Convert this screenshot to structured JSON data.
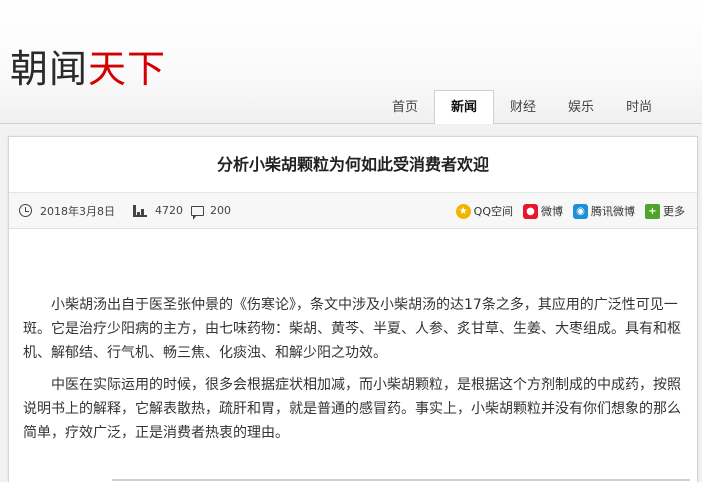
{
  "site": {
    "logo_part1": "朝闻",
    "logo_part2": "天下"
  },
  "nav": {
    "items": [
      {
        "label": "首页",
        "active": false
      },
      {
        "label": "新闻",
        "active": true
      },
      {
        "label": "财经",
        "active": false
      },
      {
        "label": "娱乐",
        "active": false
      },
      {
        "label": "时尚",
        "active": false
      }
    ]
  },
  "article": {
    "title": "分析小柴胡颗粒为何如此受消费者欢迎",
    "date": "2018年3月8日",
    "views": "4720",
    "comments": "200",
    "paragraphs": [
      "小柴胡汤出自于医圣张仲景的《伤寒论》，条文中涉及小柴胡汤的达17条之多，其应用的广泛性可见一斑。它是治疗少阳病的主方，由七味药物：柴胡、黄芩、半夏、人参、炙甘草、生姜、大枣组成。具有和枢机、解郁结、行气机、畅三焦、化痰浊、和解少阳之功效。",
      "中医在实际运用的时候，很多会根据症状相加减，而小柴胡颗粒，是根据这个方剂制成的中成药，按照说明书上的解释，它解表散热，疏肝和胃，就是普通的感冒药。事实上，小柴胡颗粒并没有你们想象的那么简单，疗效广泛，正是消费者热衷的理由。"
    ]
  },
  "share": {
    "qq": "QQ空间",
    "weibo": "微博",
    "tencent": "腾讯微博",
    "more": "更多"
  },
  "colors": {
    "logo_accent": "#d40000",
    "background": "#f2f2f2"
  }
}
